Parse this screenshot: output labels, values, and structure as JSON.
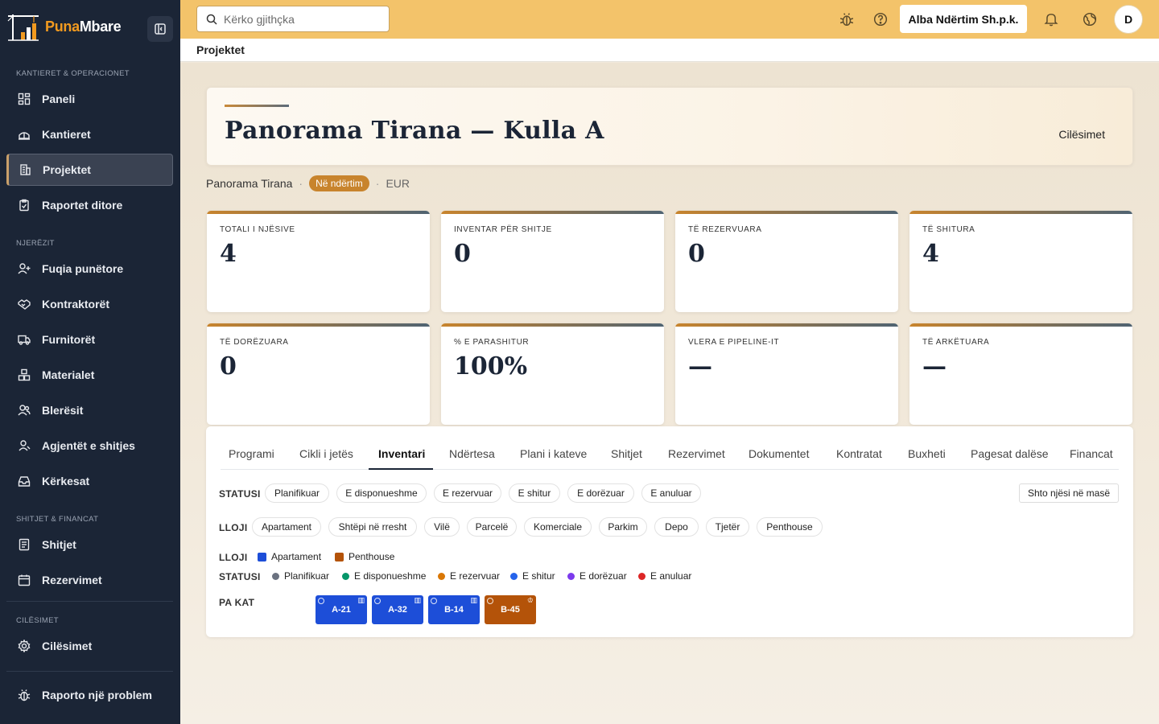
{
  "app": {
    "brand_part1": "Puna",
    "brand_part2": "Mbare"
  },
  "sidebar": {
    "sections": [
      {
        "label": "KANTIERET & OPERACIONET"
      },
      {
        "label": "NJERËZIT"
      },
      {
        "label": "SHITJET & FINANCAT"
      },
      {
        "label": "CILËSIMET"
      }
    ],
    "items": [
      {
        "label": "Paneli",
        "icon": "dashboard-icon"
      },
      {
        "label": "Kantieret",
        "icon": "site-icon"
      },
      {
        "label": "Projektet",
        "icon": "building-icon",
        "active": true
      },
      {
        "label": "Raportet ditore",
        "icon": "clipboard-icon"
      },
      {
        "label": "Fuqia punëtore",
        "icon": "user-plus-icon"
      },
      {
        "label": "Kontraktorët",
        "icon": "handshake-icon"
      },
      {
        "label": "Furnitorët",
        "icon": "truck-icon"
      },
      {
        "label": "Materialet",
        "icon": "boxes-icon"
      },
      {
        "label": "Blerësit",
        "icon": "users-icon"
      },
      {
        "label": "Agjentët e shitjes",
        "icon": "user-icon"
      },
      {
        "label": "Kërkesat",
        "icon": "inbox-icon"
      },
      {
        "label": "Shitjet",
        "icon": "receipt-icon"
      },
      {
        "label": "Rezervimet",
        "icon": "calendar-icon"
      },
      {
        "label": "Cilësimet",
        "icon": "gear-icon"
      },
      {
        "label": "Raporto një problem",
        "icon": "bug-icon"
      }
    ]
  },
  "topbar": {
    "search_placeholder": "Kërko gjithçka",
    "company": "Alba Ndërtim Sh.p.k.",
    "avatar_initial": "D"
  },
  "breadcrumb": {
    "current": "Projektet"
  },
  "project": {
    "title": "Panorama Tirana — Kulla A",
    "settings_label": "Cilësimet",
    "site": "Panorama Tirana",
    "status": "Në ndërtim",
    "currency": "EUR",
    "status_color": "#c8842d"
  },
  "stats": [
    {
      "label": "TOTALI I NJËSIVE",
      "value": "4"
    },
    {
      "label": "INVENTAR PËR SHITJE",
      "value": "0"
    },
    {
      "label": "TË REZERVUARA",
      "value": "0"
    },
    {
      "label": "TË SHITURA",
      "value": "4"
    },
    {
      "label": "TË DORËZUARA",
      "value": "0"
    },
    {
      "label": "% E PARASHITUR",
      "value": "100%"
    },
    {
      "label": "VLERA E PIPELINE-IT",
      "value": "—"
    },
    {
      "label": "TË ARKËTUARA",
      "value": "—"
    }
  ],
  "tabs": [
    {
      "label": "Programi"
    },
    {
      "label": "Cikli i jetës"
    },
    {
      "label": "Inventari",
      "active": true
    },
    {
      "label": "Ndërtesa"
    },
    {
      "label": "Plani i kateve"
    },
    {
      "label": "Shitjet"
    },
    {
      "label": "Rezervimet"
    },
    {
      "label": "Dokumentet"
    },
    {
      "label": "Kontratat"
    },
    {
      "label": "Buxheti"
    },
    {
      "label": "Pagesat dalëse"
    },
    {
      "label": "Financat"
    }
  ],
  "filters": {
    "status_label": "STATUSI",
    "status_options": [
      "Planifikuar",
      "E disponueshme",
      "E rezervuar",
      "E shitur",
      "E dorëzuar",
      "E anuluar"
    ],
    "type_label": "LLOJI",
    "type_options": [
      "Apartament",
      "Shtëpi në rresht",
      "Vilë",
      "Parcelë",
      "Komerciale",
      "Parkim",
      "Depo",
      "Tjetër",
      "Penthouse"
    ],
    "bulk_add": "Shto njësi në masë"
  },
  "legend": {
    "type_label": "LLOJI",
    "types": [
      {
        "label": "Apartament",
        "color": "#1d4ed8"
      },
      {
        "label": "Penthouse",
        "color": "#b45309"
      }
    ],
    "status_label": "STATUSI",
    "statuses": [
      {
        "label": "Planifikuar",
        "color": "#6b7280"
      },
      {
        "label": "E disponueshme",
        "color": "#059669"
      },
      {
        "label": "E rezervuar",
        "color": "#d97706"
      },
      {
        "label": "E shitur",
        "color": "#2563eb"
      },
      {
        "label": "E dorëzuar",
        "color": "#7c3aed"
      },
      {
        "label": "E anuluar",
        "color": "#dc2626"
      }
    ]
  },
  "floor_map": {
    "label": "PA KAT",
    "units": [
      {
        "code": "A-21",
        "type": "Apartament",
        "color": "#1d4ed8",
        "icon": "building-icon"
      },
      {
        "code": "A-32",
        "type": "Apartament",
        "color": "#1d4ed8",
        "icon": "building-icon"
      },
      {
        "code": "B-14",
        "type": "Apartament",
        "color": "#1d4ed8",
        "icon": "building-icon"
      },
      {
        "code": "B-45",
        "type": "Penthouse",
        "color": "#b45309",
        "icon": "crown-icon"
      }
    ]
  }
}
